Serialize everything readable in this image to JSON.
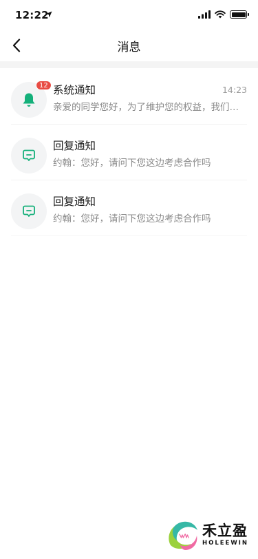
{
  "status_bar": {
    "time": "12:22",
    "icons": [
      "location-arrow-icon",
      "cellular-signal-icon",
      "wifi-icon",
      "battery-icon"
    ]
  },
  "nav": {
    "title": "消息",
    "back_icon": "chevron-left-icon"
  },
  "messages": [
    {
      "icon": "bell-icon",
      "badge": "12",
      "title": "系统通知",
      "time": "14:23",
      "preview": "亲爱的同学您好，为了维护您的权益，我们…"
    },
    {
      "icon": "chat-bubble-icon",
      "title": "回复通知",
      "preview": "约翰：您好，请问下您这边考虑合作吗"
    },
    {
      "icon": "chat-bubble-icon",
      "title": "回复通知",
      "preview": "约翰：您好，请问下您这边考虑合作吗"
    }
  ],
  "watermark": {
    "name_cn": "禾立盈",
    "name_en": "HOLEEWIN"
  },
  "colors": {
    "accent_green": "#14b07a",
    "badge_red": "#e84c44",
    "avatar_bg": "#f3f4f5",
    "divider_band": "#f4f4f4"
  }
}
